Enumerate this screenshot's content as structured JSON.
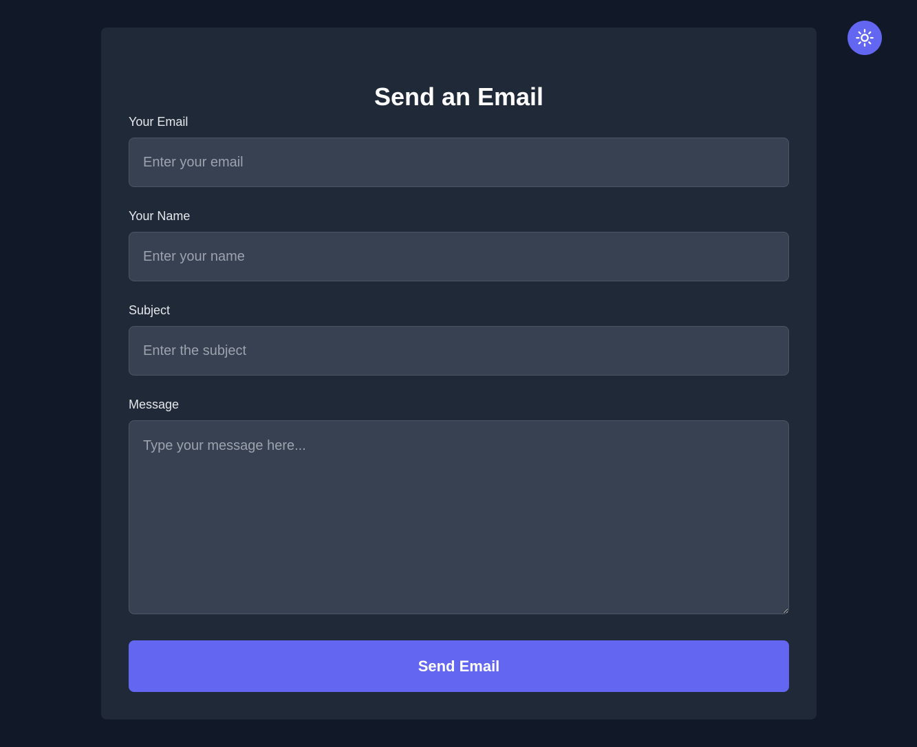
{
  "form": {
    "title": "Send an Email",
    "fields": [
      {
        "label": "Your Email",
        "placeholder": "Enter your email",
        "value": ""
      },
      {
        "label": "Your Name",
        "placeholder": "Enter your name",
        "value": ""
      },
      {
        "label": "Subject",
        "placeholder": "Enter the subject",
        "value": ""
      },
      {
        "label": "Message",
        "placeholder": "Type your message here...",
        "value": ""
      }
    ],
    "submit_label": "Send Email"
  },
  "theme_toggle": {
    "icon": "sun-icon"
  },
  "colors": {
    "background": "#111827",
    "card": "#1f2937",
    "input": "#374151",
    "accent": "#6366f1"
  }
}
